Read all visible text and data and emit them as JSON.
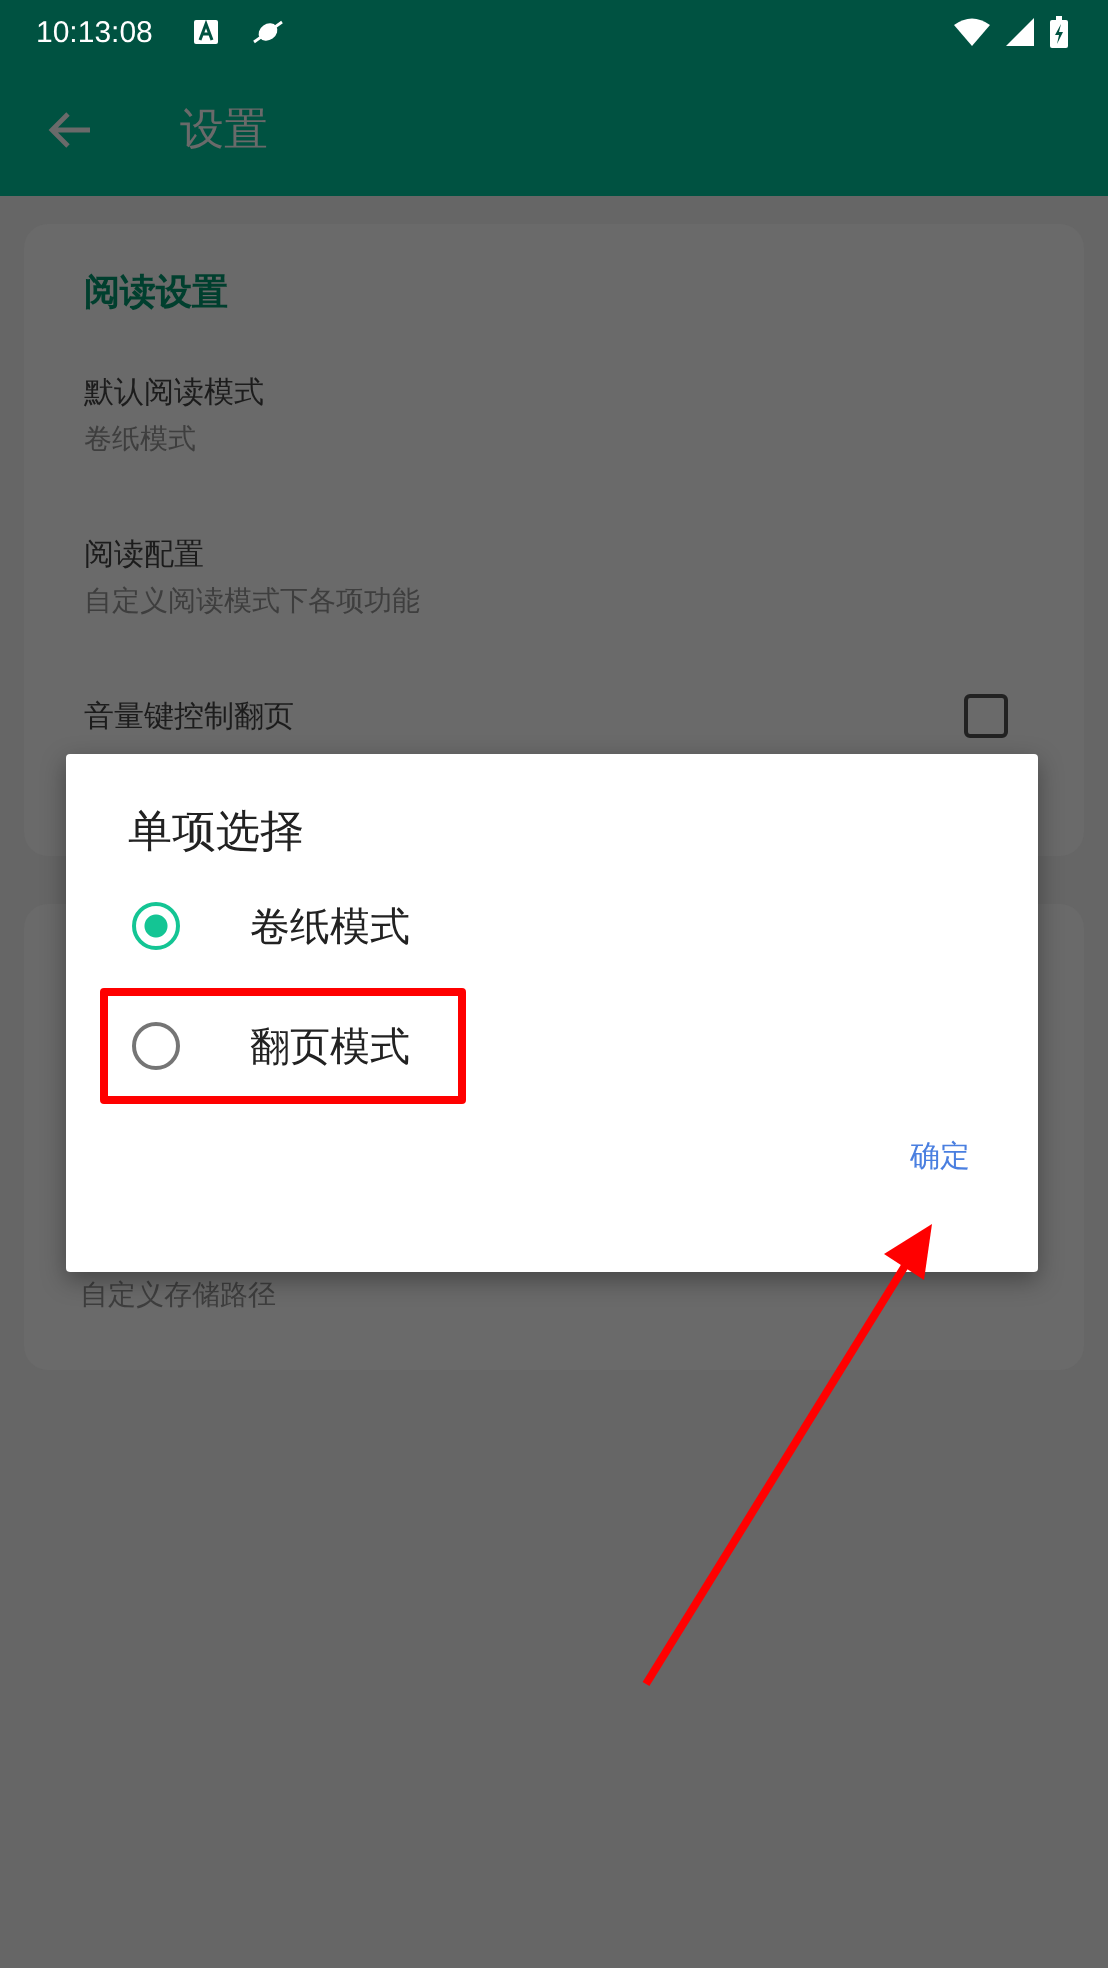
{
  "status_bar": {
    "time": "10:13:08"
  },
  "app_bar": {
    "title": "设置"
  },
  "sections": [
    {
      "title": "阅读设置",
      "items": [
        {
          "kind": "text",
          "title": "默认阅读模式",
          "subtitle": "卷纸模式"
        },
        {
          "kind": "text",
          "title": "阅读配置",
          "subtitle": "自定义阅读模式下各项功能"
        },
        {
          "kind": "checkbox",
          "title": "音量键控制翻页",
          "checked": false
        }
      ]
    },
    {
      "items": [
        {
          "kind": "text",
          "subtitle": "自定义存储路径"
        }
      ]
    }
  ],
  "dialog": {
    "title": "单项选择",
    "options": [
      {
        "label": "卷纸模式",
        "selected": true,
        "highlighted": false
      },
      {
        "label": "翻页模式",
        "selected": false,
        "highlighted": true
      }
    ],
    "confirm": {
      "label": "确定",
      "highlighted": true
    }
  }
}
